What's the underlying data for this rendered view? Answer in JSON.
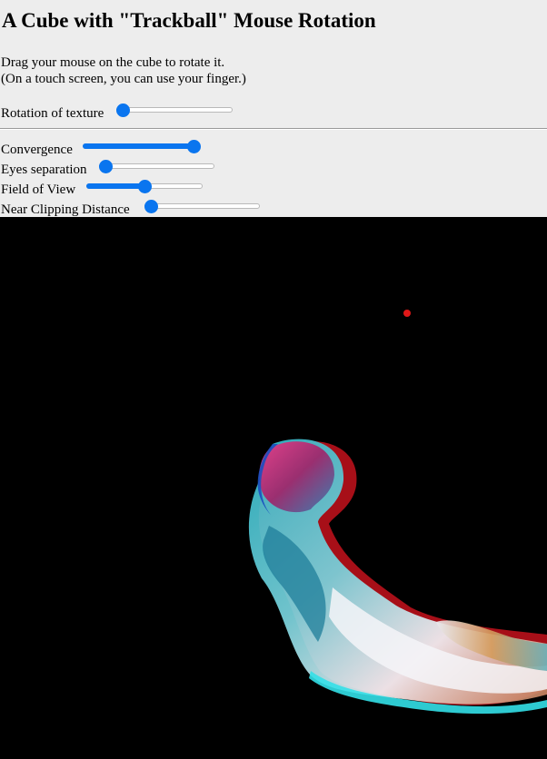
{
  "page": {
    "title": "A Cube with \"Trackball\" Mouse Rotation",
    "instructions_line1": "Drag your mouse on the cube to rotate it.",
    "instructions_line2": "(On a touch screen, you can use your finger.)"
  },
  "controls": {
    "texture_rotation": {
      "label": "Rotation of texture",
      "value": 0.0
    },
    "convergence": {
      "label": "Convergence",
      "value": 1.0
    },
    "eye_separation": {
      "label": "Eyes separation",
      "value": 0.0
    },
    "field_of_view": {
      "label": "Field of View",
      "value": 0.5
    },
    "near_clipping": {
      "label": "Near Clipping Distance",
      "value": 0.0
    }
  },
  "colors": {
    "background": "#ededed",
    "slider_accent": "#0a75ef",
    "canvas_background": "#000000",
    "marker": "#e01818"
  }
}
